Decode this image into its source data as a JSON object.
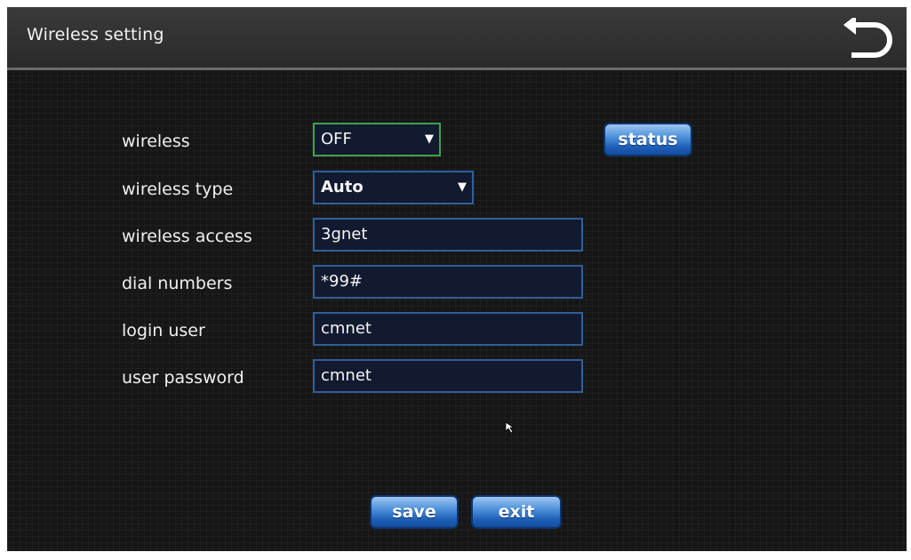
{
  "header": {
    "title": "Wireless setting",
    "back_icon": "undo-arrow-icon"
  },
  "form": {
    "wireless": {
      "label": "wireless",
      "value": "OFF"
    },
    "wireless_type": {
      "label": "wireless type",
      "value": "Auto"
    },
    "wireless_access": {
      "label": "wireless access",
      "value": "3gnet"
    },
    "dial_numbers": {
      "label": "dial numbers",
      "value": "*99#"
    },
    "login_user": {
      "label": "login user",
      "value": "cmnet"
    },
    "user_password": {
      "label": "user password",
      "value": "cmnet"
    }
  },
  "buttons": {
    "status": "status",
    "save": "save",
    "exit": "exit"
  },
  "colors": {
    "accent_blue": "#1d5fb8",
    "field_border": "#2f5f9a",
    "active_border": "#3fa24a",
    "background": "#161616"
  }
}
